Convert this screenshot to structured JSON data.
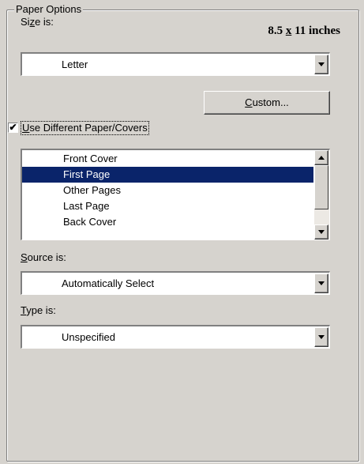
{
  "paper_options": {
    "group_title": "Paper Options",
    "size_label_pre": "Si",
    "size_label_accel": "z",
    "size_label_post": "e is:",
    "size_value_num1": "8.5",
    "size_value_x": "x",
    "size_value_rest": " 11 inches",
    "size_selected": "Letter",
    "custom_button_accel": "C",
    "custom_button_rest": "ustom...",
    "use_different_checked": true,
    "use_different_check_glyph": "✔",
    "use_different_accel": "U",
    "use_different_rest": "se Different Paper/Covers",
    "pages_list": [
      "Front Cover",
      "First Page",
      "Other Pages",
      "Last Page",
      "Back Cover"
    ],
    "pages_selected": "First Page",
    "source_label_accel": "S",
    "source_label_rest": "ource is:",
    "source_selected": "Automatically Select",
    "type_label_accel": "T",
    "type_label_rest": "ype is:",
    "type_selected": "Unspecified"
  }
}
